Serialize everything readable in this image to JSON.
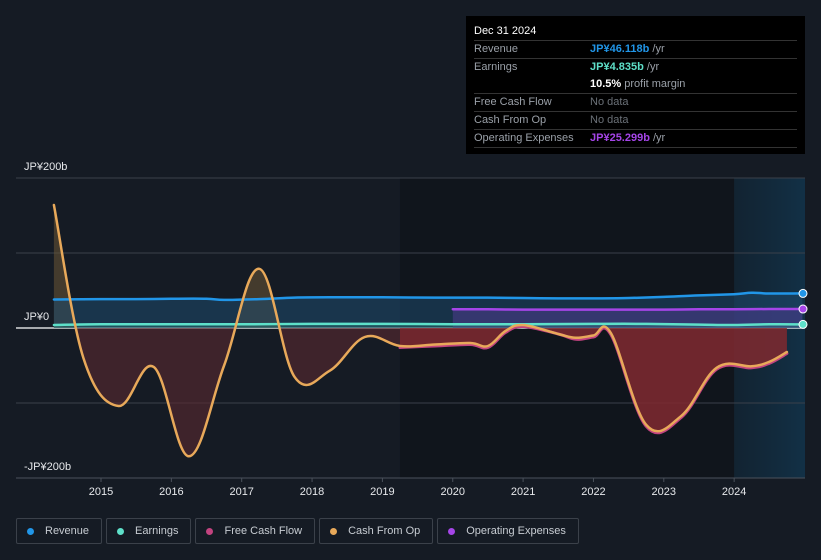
{
  "tooltip": {
    "date": "Dec 31 2024",
    "rows": [
      {
        "label": "Revenue",
        "value": "JP¥46.118b",
        "suffix": " /yr",
        "color": "#2196e8"
      },
      {
        "label": "Earnings",
        "value": "JP¥4.835b",
        "suffix": " /yr",
        "color": "#5ee0c9"
      },
      {
        "label": "",
        "value": "10.5%",
        "suffix": " profit margin",
        "color": "#ffffff"
      },
      {
        "label": "Free Cash Flow",
        "value": "No data",
        "suffix": "",
        "color": "#6b7178"
      },
      {
        "label": "Cash From Op",
        "value": "No data",
        "suffix": "",
        "color": "#6b7178"
      },
      {
        "label": "Operating Expenses",
        "value": "JP¥25.299b",
        "suffix": " /yr",
        "color": "#a545e8"
      }
    ]
  },
  "legend": [
    {
      "label": "Revenue",
      "color": "#2196e8"
    },
    {
      "label": "Earnings",
      "color": "#5ee0c9"
    },
    {
      "label": "Free Cash Flow",
      "color": "#c2437f"
    },
    {
      "label": "Cash From Op",
      "color": "#e8a95a"
    },
    {
      "label": "Operating Expenses",
      "color": "#a545e8"
    }
  ],
  "chart_data": {
    "type": "area",
    "title": "",
    "xlabel": "",
    "ylabel": "",
    "y_tick_labels": [
      "JP¥200b",
      "JP¥0",
      "-JP¥200b"
    ],
    "ylim": [
      -200,
      200
    ],
    "xlim": [
      2013.8,
      2025.0
    ],
    "x_tick_labels": [
      "2015",
      "2016",
      "2017",
      "2018",
      "2019",
      "2020",
      "2021",
      "2022",
      "2023",
      "2024"
    ],
    "x_ticks": [
      2015,
      2016,
      2017,
      2018,
      2019,
      2020,
      2021,
      2022,
      2023,
      2024
    ],
    "highlight_range": [
      2024.0,
      2025.0
    ],
    "grid": true,
    "unit": "JP¥ billions",
    "series": [
      {
        "name": "Revenue",
        "color": "#2196e8",
        "x": [
          2014.33,
          2015.0,
          2015.5,
          2016.0,
          2016.5,
          2016.75,
          2017.25,
          2017.75,
          2018.25,
          2019.0,
          2019.75,
          2020.5,
          2021.0,
          2021.5,
          2022.0,
          2022.5,
          2023.0,
          2023.5,
          2024.0,
          2024.25,
          2024.5,
          2024.97
        ],
        "y": [
          38,
          38.5,
          38.5,
          39,
          39,
          37.5,
          38.5,
          40.5,
          41,
          41,
          40.5,
          40.5,
          40,
          39.5,
          39.5,
          40,
          41.5,
          43.5,
          45,
          47,
          46,
          46.1
        ]
      },
      {
        "name": "Earnings",
        "color": "#5ee0c9",
        "x": [
          2014.33,
          2015.0,
          2016.0,
          2017.0,
          2018.0,
          2019.0,
          2020.0,
          2021.0,
          2022.0,
          2022.75,
          2023.5,
          2024.0,
          2024.5,
          2024.97
        ],
        "y": [
          4,
          5,
          5,
          5,
          5.5,
          5.5,
          5,
          5,
          5.5,
          5.5,
          4.5,
          4,
          5,
          4.8
        ]
      },
      {
        "name": "Free Cash Flow",
        "color": "#c2437f",
        "x": [
          2019.25,
          2019.75,
          2020.25,
          2020.5,
          2020.75,
          2021.0,
          2021.5,
          2021.75,
          2022.0,
          2022.25,
          2022.75,
          2023.25,
          2023.75,
          2024.25,
          2024.5,
          2024.75
        ],
        "y": [
          -26,
          -24,
          -22,
          -26,
          -6,
          2,
          -8,
          -15,
          -12,
          -9,
          -131,
          -119,
          -55,
          -53,
          -47,
          -34
        ]
      },
      {
        "name": "Cash From Op",
        "color": "#e8a95a",
        "x": [
          2014.33,
          2014.75,
          2015.25,
          2015.75,
          2016.25,
          2016.75,
          2017.25,
          2017.75,
          2018.25,
          2018.75,
          2019.25,
          2019.75,
          2020.25,
          2020.5,
          2020.75,
          2021.0,
          2021.5,
          2021.75,
          2022.0,
          2022.25,
          2022.75,
          2023.25,
          2023.75,
          2024.25,
          2024.5,
          2024.75
        ],
        "y": [
          164,
          -40,
          -104,
          -52,
          -171,
          -50,
          79,
          -65,
          -57,
          -12,
          -24,
          -22,
          -20,
          -24,
          -4,
          4,
          -8,
          -13,
          -10,
          -7,
          -129,
          -117,
          -53,
          -51,
          -45,
          -32
        ]
      },
      {
        "name": "Operating Expenses",
        "color": "#a545e8",
        "x": [
          2020.0,
          2020.5,
          2021.0,
          2021.5,
          2022.0,
          2022.5,
          2023.0,
          2023.5,
          2024.0,
          2024.5,
          2024.97
        ],
        "y": [
          25,
          25,
          24.5,
          24.5,
          24.5,
          24.5,
          24.5,
          25,
          25,
          25.3,
          25.3
        ]
      }
    ]
  }
}
